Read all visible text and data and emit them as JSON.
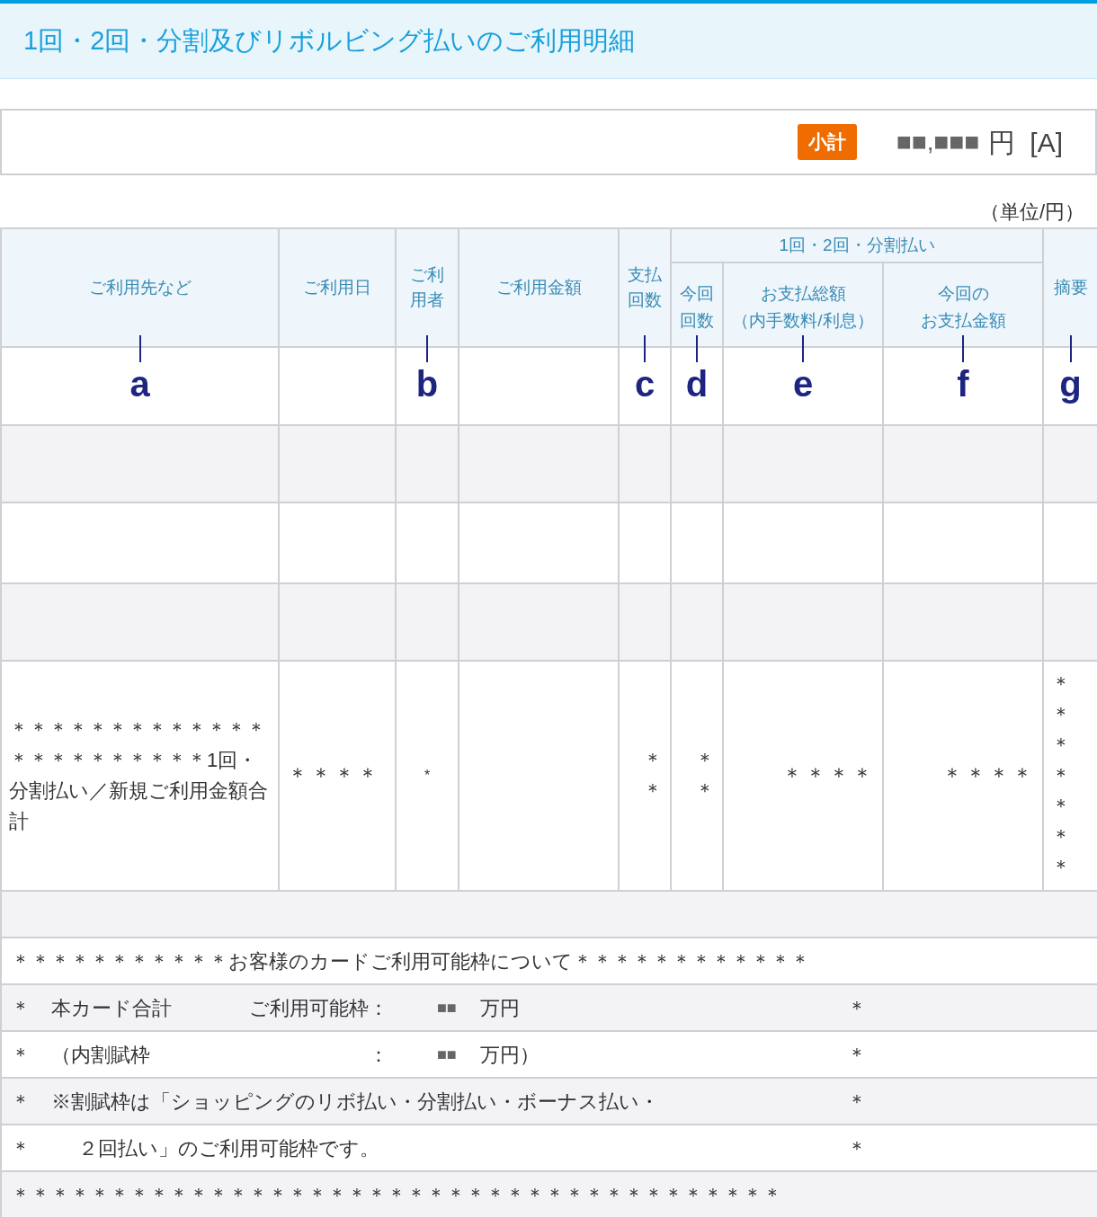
{
  "title": "1回・2回・分割及びリボルビング払いのご利用明細",
  "subtotal": {
    "badge": "小計",
    "amount": "■■,■■■",
    "unit": "円",
    "tag": "[A]"
  },
  "unit_note": "（単位/円）",
  "table": {
    "group_header": "1回・2回・分割払い",
    "columns": [
      {
        "lines": [
          "ご利用先など"
        ],
        "marker": "a"
      },
      {
        "lines": [
          "ご利用日"
        ]
      },
      {
        "lines": [
          "ご利",
          "用者"
        ],
        "marker": "b"
      },
      {
        "lines": [
          "ご利用金額"
        ]
      },
      {
        "lines": [
          "支払",
          "回数"
        ],
        "marker": "c"
      },
      {
        "lines": [
          "今回",
          "回数"
        ],
        "marker": "d"
      },
      {
        "lines": [
          "お支払総額",
          "（内手数料/利息）"
        ],
        "marker": "e"
      },
      {
        "lines": [
          "今回の",
          "お支払金額"
        ],
        "marker": "f"
      },
      {
        "lines": [
          "摘要"
        ],
        "marker": "g"
      }
    ],
    "rows": [
      {
        "kind": "empty"
      },
      {
        "kind": "empty"
      },
      {
        "kind": "empty"
      },
      {
        "kind": "data",
        "cells": [
          "＊＊＊＊＊＊＊＊＊＊＊＊＊＊＊＊＊＊＊＊＊＊＊1回・分割払い／新規ご利用金額合計",
          "＊＊＊＊",
          "*",
          null,
          "＊＊",
          "＊＊",
          "＊＊＊＊",
          "＊＊＊＊",
          "＊＊＊＊＊＊＊"
        ]
      },
      {
        "kind": "empty"
      }
    ],
    "notes": [
      {
        "kind": "banner",
        "text": "＊＊＊＊＊＊＊＊＊＊＊お客様のカードご利用可能枠について＊＊＊＊＊＊＊＊＊＊＊＊"
      },
      {
        "kind": "limit",
        "start": "＊",
        "label": "本カード合計",
        "field": "ご利用可能枠：",
        "amount": "■■",
        "unit": "万円",
        "end": "＊"
      },
      {
        "kind": "limit",
        "start": "＊",
        "label": "（内割賦枠",
        "field": "：",
        "amount": "■■",
        "unit": "万円）",
        "end": "＊"
      },
      {
        "kind": "note",
        "start": "＊",
        "text": "※割賦枠は「ショッピングのリボ払い・分割払い・ボーナス払い・",
        "end": "＊"
      },
      {
        "kind": "continuation",
        "start": "＊",
        "text": "２回払い」のご利用可能枠です。",
        "end": "＊"
      },
      {
        "kind": "banner",
        "text": "＊＊＊＊＊＊＊＊＊＊＊＊＊＊＊＊＊＊＊＊＊＊＊＊＊＊＊＊＊＊＊＊＊＊＊＊＊＊＊"
      }
    ]
  }
}
